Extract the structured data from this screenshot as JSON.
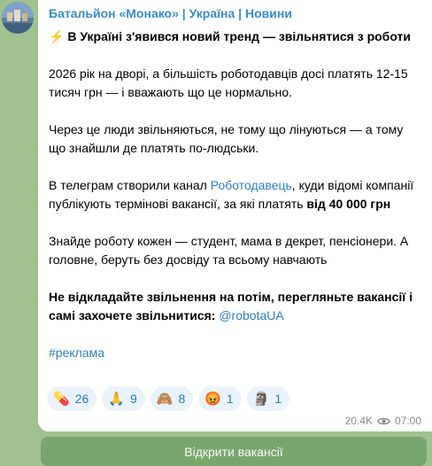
{
  "post": {
    "channel": "Батальйон «Монако» | Україна | Новини",
    "headline_emoji": "⚡",
    "headline": "В Україні з'явився новий тренд — звільнятися з роботи",
    "p1": "2026 рік на дворі, а більшість роботодавців досі платять 12-15 тисяч грн — і вважають що це нормально.",
    "p2": "Через це люди звільняються, не тому що лінуються — а тому що знайшли де платять по-людськи.",
    "p3_before": "В телеграм створили канал ",
    "p3_link": "Роботодавець",
    "p3_middle": ", куди відомі компанії публікують термінові вакансії, за які платять ",
    "p3_bold": "від 40 000 грн",
    "p4": "Знайде роботу кожен — студент, мама в декрет, пенсіонери. А головне, беруть без досвіду та всьому навчають",
    "p5_bold": "Не відкладайте звільнення на потім, перегляньте вакансії і самі захочете звільнитися: ",
    "p5_link": "@robotaUA",
    "hashtag": "#реклама"
  },
  "reactions": [
    {
      "emoji": "💊",
      "count": "26"
    },
    {
      "emoji": "🙏",
      "count": "9"
    },
    {
      "emoji": "🙈",
      "count": "8"
    },
    {
      "emoji": "😡",
      "count": "1"
    },
    {
      "emoji": "🗿",
      "count": "1"
    }
  ],
  "meta": {
    "views": "20.4K",
    "time": "07:00"
  },
  "cta": {
    "label": "Відкрити вакансії"
  },
  "colors": {
    "background": "#9fc28e",
    "channel": "#3a8cc8",
    "link": "#2f7fc1",
    "button": "#7aa66e"
  }
}
